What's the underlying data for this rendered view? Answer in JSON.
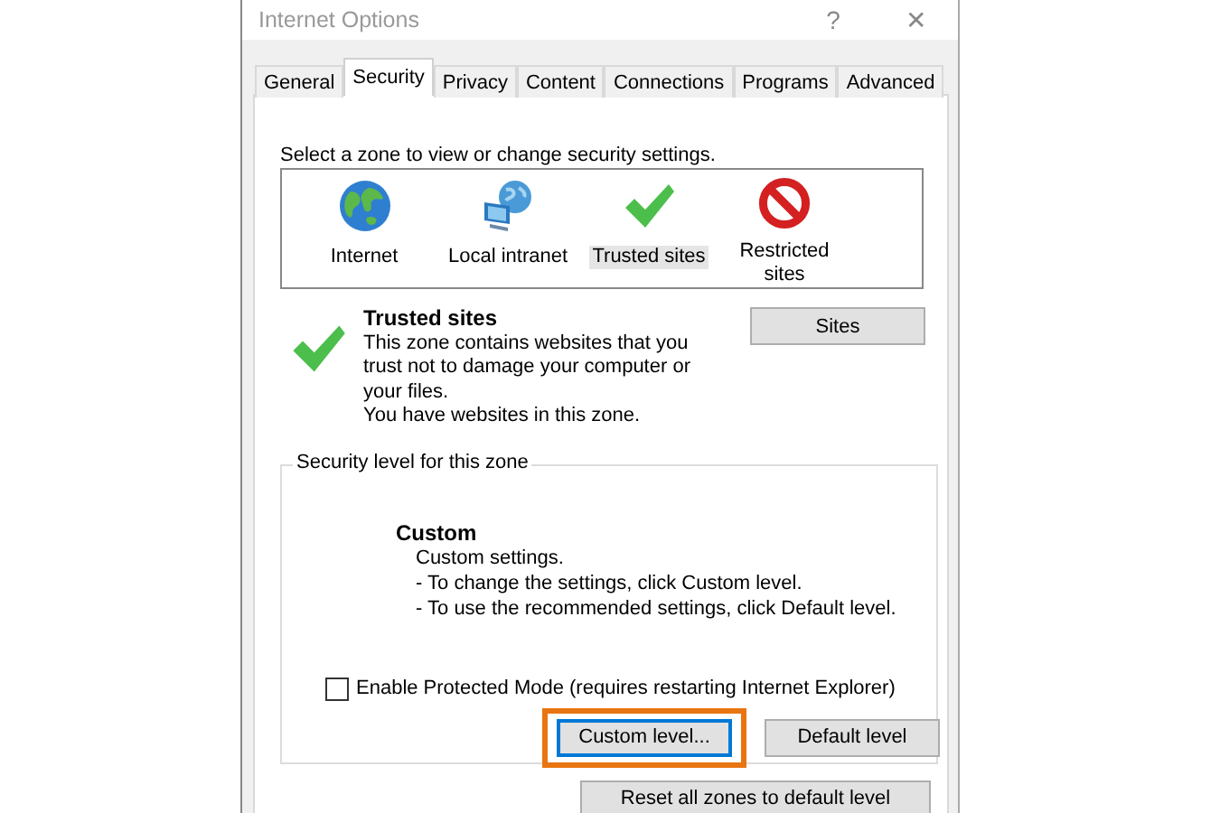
{
  "window": {
    "title": "Internet Options",
    "help": "?",
    "close": "✕"
  },
  "tabs": [
    {
      "label": "General",
      "selected": false
    },
    {
      "label": "Security",
      "selected": true
    },
    {
      "label": "Privacy",
      "selected": false
    },
    {
      "label": "Content",
      "selected": false
    },
    {
      "label": "Connections",
      "selected": false
    },
    {
      "label": "Programs",
      "selected": false
    },
    {
      "label": "Advanced",
      "selected": false
    }
  ],
  "zone_prompt": "Select a zone to view or change security settings.",
  "zones": [
    {
      "label": "Internet",
      "kind": "globe",
      "selected": false
    },
    {
      "label": "Local intranet",
      "kind": "network",
      "selected": false
    },
    {
      "label": "Trusted sites",
      "kind": "check",
      "selected": true
    },
    {
      "label": "Restricted sites",
      "kind": "forbidden",
      "selected": false
    }
  ],
  "zone_info": {
    "title": "Trusted sites",
    "kind": "check",
    "lines": [
      "This zone contains websites that you trust not to damage your computer or your files.",
      "You have websites in this zone."
    ],
    "sites_button": "Sites"
  },
  "security_level": {
    "legend": "Security level for this zone",
    "title": "Custom",
    "lines": [
      "Custom settings.",
      "- To change the settings, click Custom level.",
      "- To use the recommended settings, click Default level."
    ],
    "protected_mode": {
      "label": "Enable Protected Mode (requires restarting Internet Explorer)",
      "checked": false
    },
    "buttons": [
      {
        "label": "Custom level...",
        "highlighted": true
      },
      {
        "label": "Default level",
        "highlighted": false
      }
    ]
  },
  "reset_button": "Reset all zones to default level"
}
